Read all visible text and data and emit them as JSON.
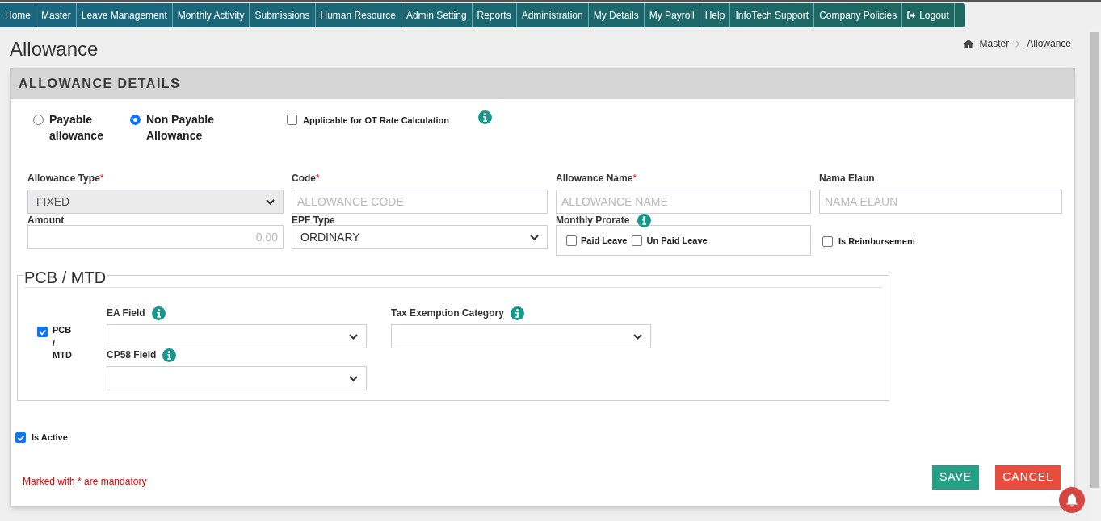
{
  "nav": [
    {
      "label": "Home"
    },
    {
      "label": "Master"
    },
    {
      "label": "Leave Management"
    },
    {
      "label": "Monthly Activity"
    },
    {
      "label": "Submissions"
    },
    {
      "label": "Human Resource"
    },
    {
      "label": "Admin Setting"
    },
    {
      "label": "Reports"
    },
    {
      "label": "Administration"
    },
    {
      "label": "My Details"
    },
    {
      "label": "My Payroll"
    },
    {
      "label": "Help"
    },
    {
      "label": "InfoTech Support"
    },
    {
      "label": "Company Policies"
    },
    {
      "label": "Logout",
      "kind": "logout"
    }
  ],
  "page_title": "Allowance",
  "breadcrumb": [
    "Master",
    "Allowance"
  ],
  "card": {
    "title": "ALLOWANCE DETAILS",
    "allowance_class": [
      {
        "label": "Payable allowance",
        "selected": false
      },
      {
        "label": "Non Payable Allowance",
        "selected": true
      }
    ],
    "ot_rate": {
      "label": "Applicable for OT Rate Calculation",
      "checked": false,
      "info": true
    },
    "fields": [
      {
        "kind": "select",
        "label": "Allowance Type",
        "required_mark": "*",
        "value": "FIXED",
        "disabled": true
      },
      {
        "kind": "input",
        "label": "Code",
        "required_mark": "*",
        "placeholder": "ALLOWANCE CODE"
      },
      {
        "kind": "input",
        "label": "Allowance Name",
        "required_mark": "*",
        "placeholder": "ALLOWANCE NAME"
      },
      {
        "kind": "input",
        "label": "Nama Elaun",
        "placeholder": "NAMA ELAUN"
      },
      {
        "kind": "number",
        "label": "Amount",
        "placeholder": "0.00"
      },
      {
        "kind": "select",
        "label": "EPF Type",
        "value": "ORDINARY",
        "disabled": false
      },
      {
        "kind": "checkgroup",
        "label": "Monthly Prorate",
        "info": true,
        "options": [
          {
            "label": "Paid Leave",
            "checked": false
          },
          {
            "label": "Un Paid Leave",
            "checked": false
          }
        ]
      },
      {
        "kind": "checkbox",
        "label": "Is Reimbursement",
        "checked": false
      }
    ],
    "pcb": {
      "legend": "PCB / MTD",
      "toggle": {
        "label": "PCB / MTD",
        "checked": true
      },
      "fields": [
        {
          "label": "EA Field",
          "info": true
        },
        {
          "label": "Tax Exemption Category",
          "info": true
        },
        {
          "label": "CP58 Field",
          "info": true
        }
      ]
    },
    "is_active": {
      "label": "Is Active",
      "checked": true
    },
    "note": "Marked with * are mandatory",
    "buttons": [
      {
        "label": "SAVE",
        "kind": "primary"
      },
      {
        "label": "CANCEL",
        "kind": "danger"
      }
    ]
  }
}
